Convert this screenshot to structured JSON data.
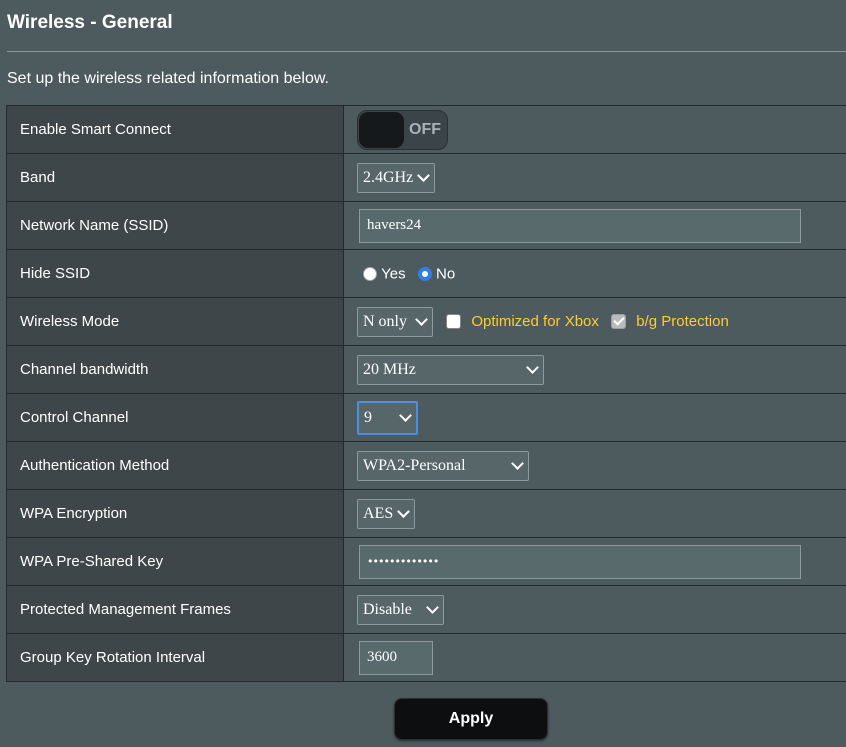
{
  "page": {
    "title": "Wireless - General",
    "subtitle": "Set up the wireless related information below."
  },
  "rows": {
    "smart_connect": {
      "label": "Enable Smart Connect",
      "toggle_text": "OFF"
    },
    "band": {
      "label": "Band",
      "value": "2.4GHz"
    },
    "ssid": {
      "label": "Network Name (SSID)",
      "value": "havers24"
    },
    "hide_ssid": {
      "label": "Hide SSID",
      "option_yes": "Yes",
      "option_no": "No",
      "selected": "No"
    },
    "wireless_mode": {
      "label": "Wireless Mode",
      "value": "N only",
      "xbox_label": "Optimized for Xbox",
      "xbox_checked": false,
      "bg_label": "b/g Protection",
      "bg_checked": true
    },
    "channel_bandwidth": {
      "label": "Channel bandwidth",
      "value": "20 MHz"
    },
    "control_channel": {
      "label": "Control Channel",
      "value": "9"
    },
    "auth_method": {
      "label": "Authentication Method",
      "value": "WPA2-Personal"
    },
    "wpa_encryption": {
      "label": "WPA Encryption",
      "value": "AES"
    },
    "psk": {
      "label": "WPA Pre-Shared Key",
      "value": "•••••••••••••"
    },
    "pmf": {
      "label": "Protected Management Frames",
      "value": "Disable"
    },
    "gkri": {
      "label": "Group Key Rotation Interval",
      "value": "3600"
    }
  },
  "buttons": {
    "apply": "Apply"
  },
  "colors": {
    "background": "#4d5a5e",
    "label_cell": "#3e4649",
    "accent_yellow": "#ffcc33",
    "radio_blue": "#2f7fe8"
  }
}
